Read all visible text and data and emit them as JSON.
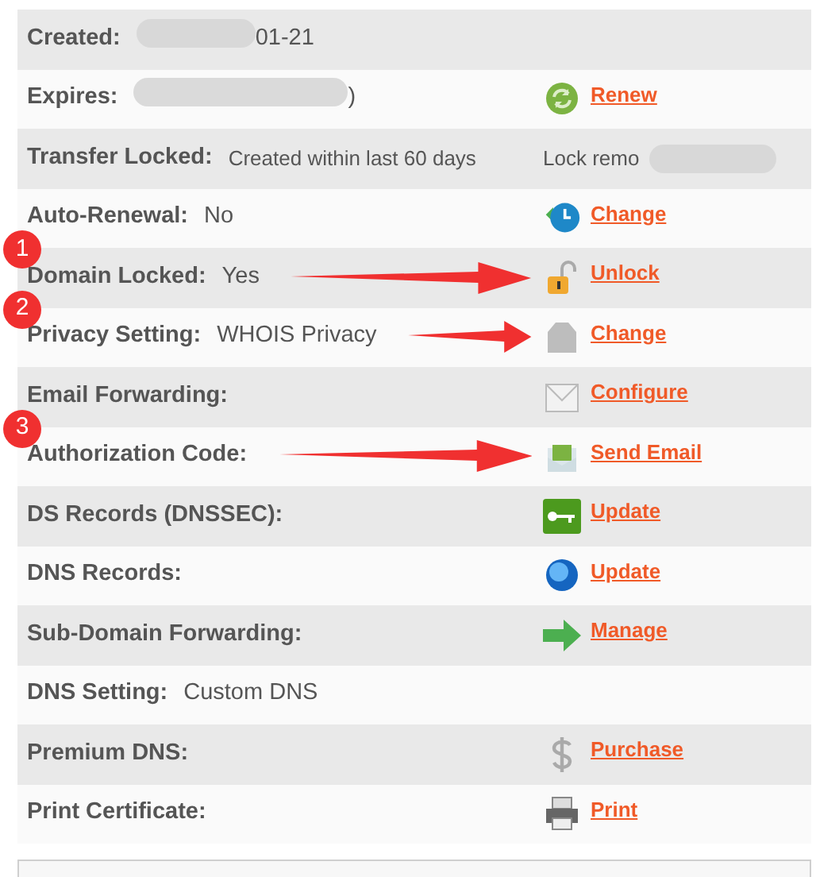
{
  "rows": [
    {
      "label": "Created:",
      "value": "01-21",
      "blurred": true
    },
    {
      "label": "Expires:",
      "value": ")",
      "blurred": true,
      "kind": "refresh",
      "action": "Renew"
    },
    {
      "label": "Transfer Locked:",
      "value": "Created within last 60 days",
      "note": "Lock remo",
      "note_blurred": true
    },
    {
      "label": "Auto-Renewal:",
      "value": "No",
      "kind": "clock",
      "action": "Change"
    },
    {
      "label": "Domain Locked:",
      "value": "Yes",
      "kind": "padlock",
      "action": "Unlock",
      "marker": "1",
      "arrow": true
    },
    {
      "label": "Privacy Setting:",
      "value": "WHOIS Privacy",
      "kind": "tag",
      "action": "Change",
      "marker": "2",
      "arrow": true
    },
    {
      "label": "Email Forwarding:",
      "kind": "envelope",
      "action": "Configure"
    },
    {
      "label": "Authorization Code:",
      "kind": "mail",
      "action": "Send Email",
      "marker": "3",
      "arrow": true
    },
    {
      "label": "DS Records (DNSSEC):",
      "kind": "key",
      "action": "Update"
    },
    {
      "label": "DNS Records:",
      "kind": "globe",
      "action": "Update"
    },
    {
      "label": "Sub-Domain Forwarding:",
      "kind": "arrow",
      "action": "Manage"
    },
    {
      "label": "DNS Setting:",
      "value": "Custom DNS"
    },
    {
      "label": "Premium DNS:",
      "kind": "dollar",
      "action": "Purchase"
    },
    {
      "label": "Print Certificate:",
      "kind": "printer",
      "action": "Print"
    }
  ]
}
